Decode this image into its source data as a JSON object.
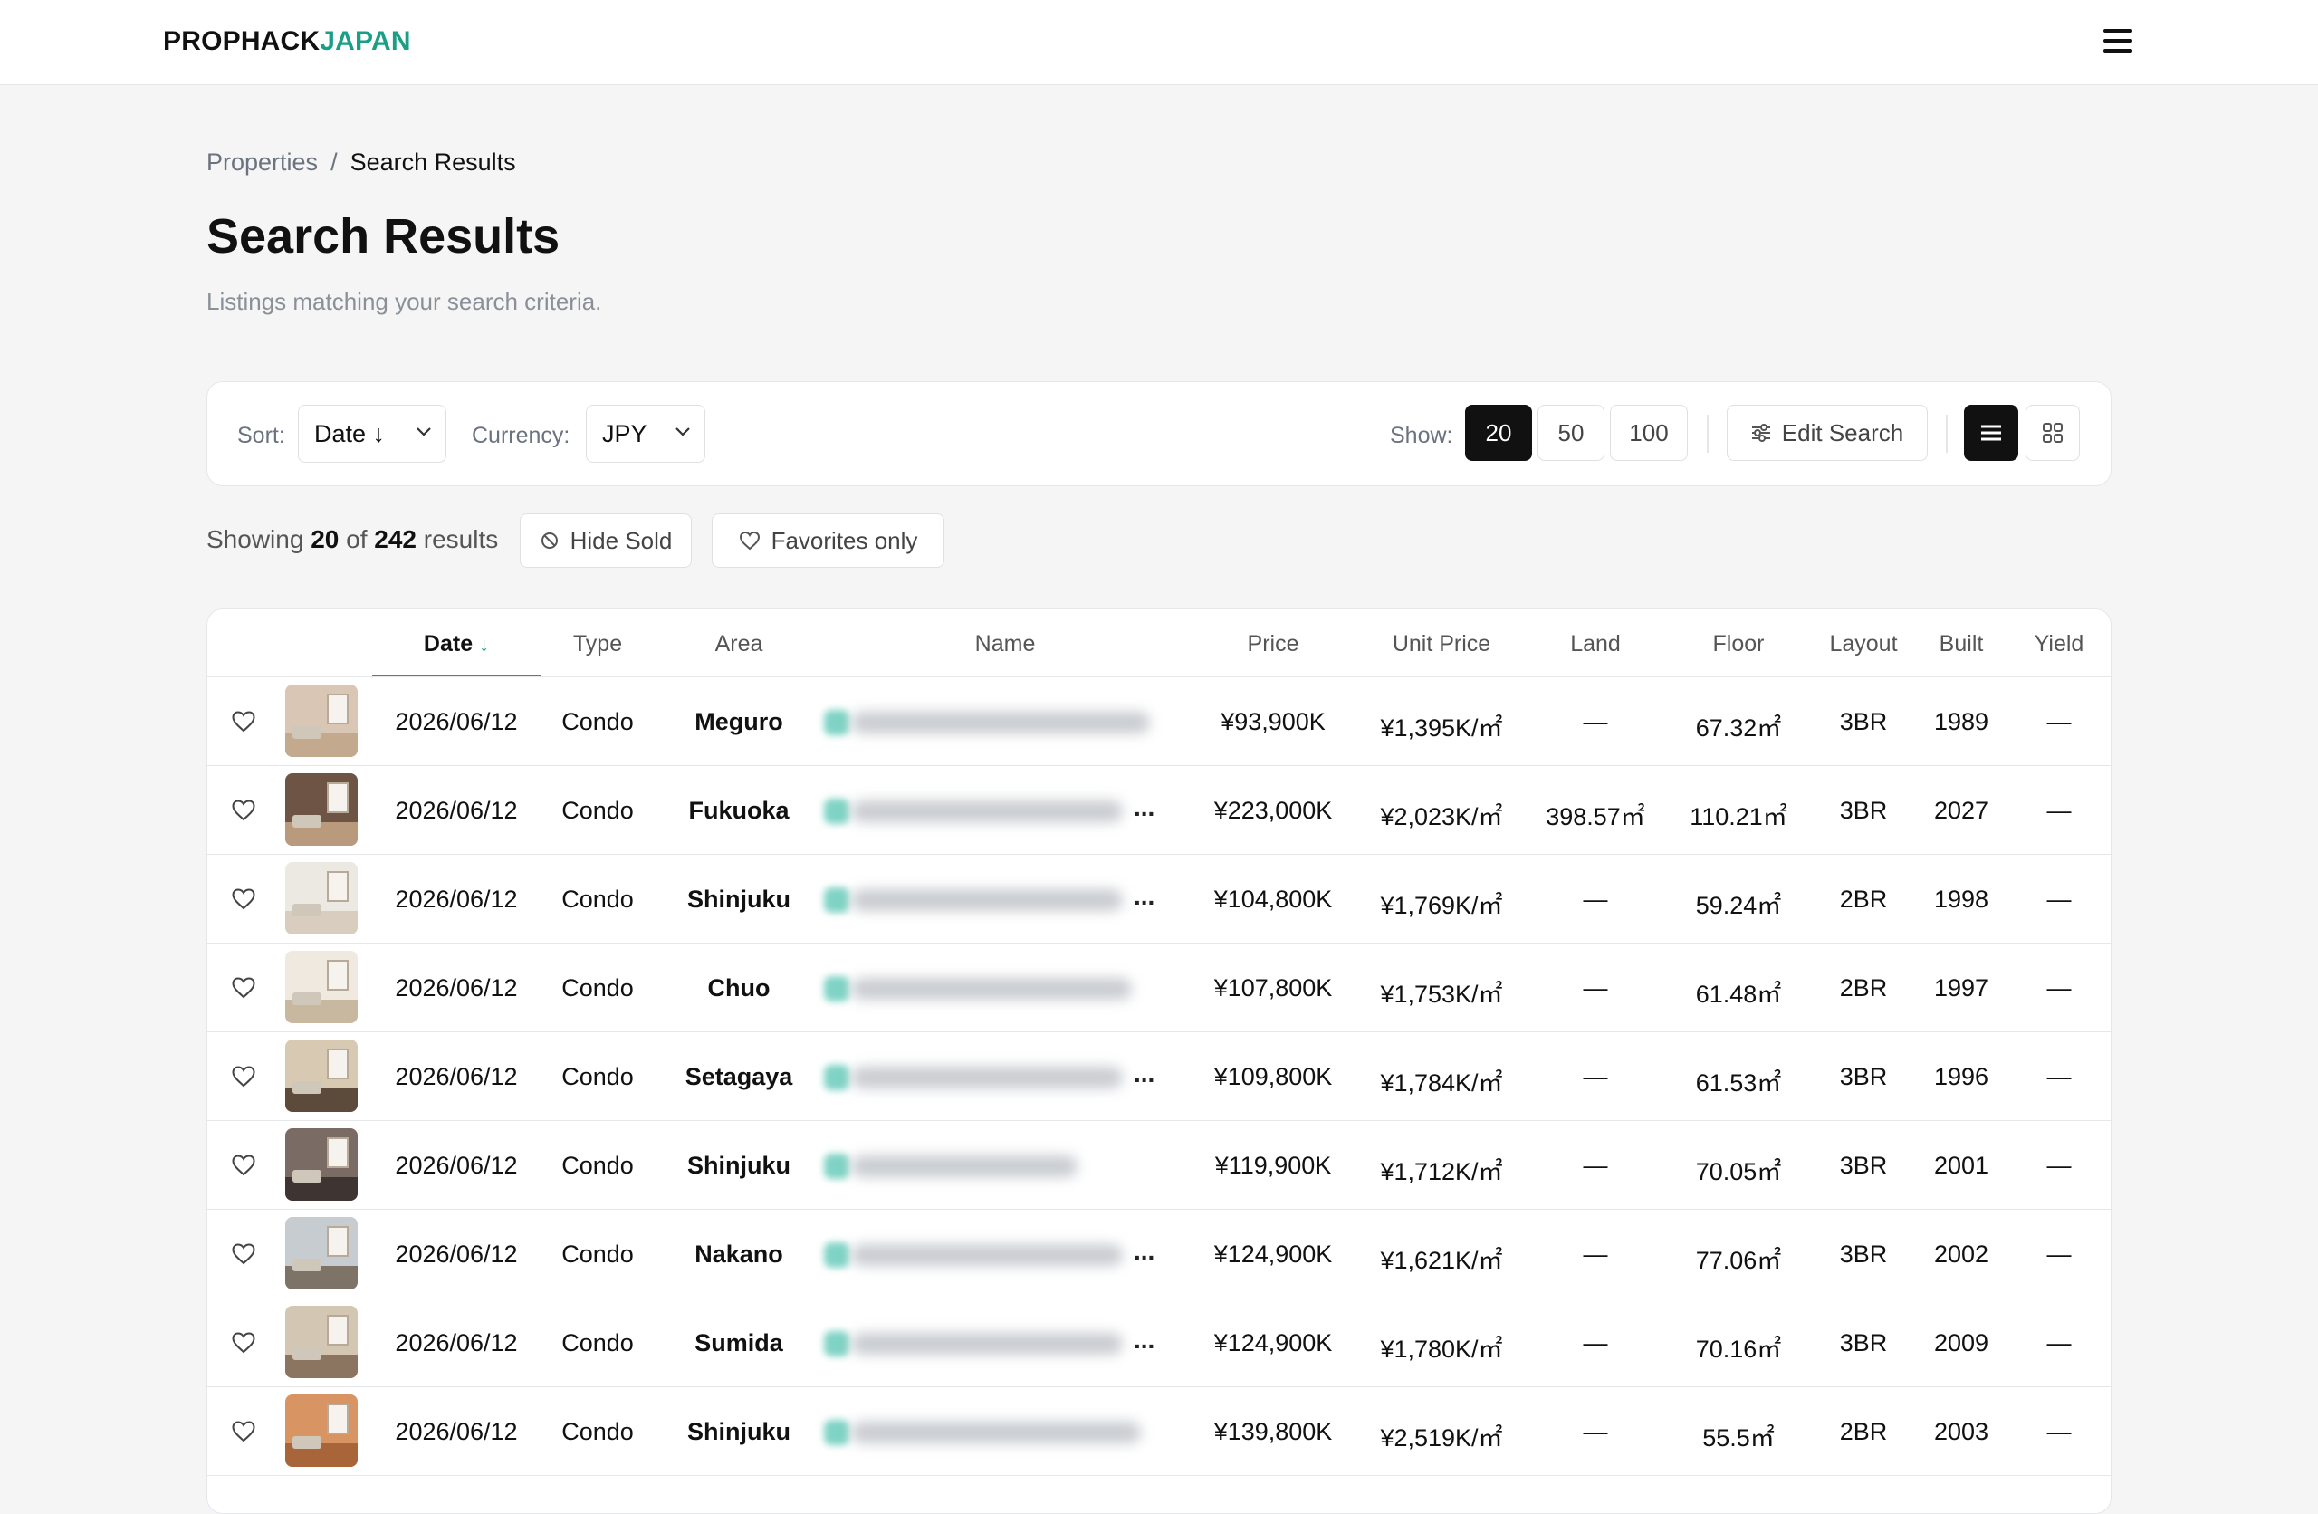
{
  "header": {
    "logo_part1": "PROPHACK",
    "logo_part2": "JAPAN",
    "menu_icon": "hamburger-menu-icon"
  },
  "breadcrumb": {
    "items": [
      "Properties",
      "Search Results"
    ],
    "separator": "/"
  },
  "page": {
    "title": "Search Results",
    "subtitle": "Listings matching your search criteria."
  },
  "toolbar": {
    "sort_label": "Sort:",
    "sort_value": "Date ↓",
    "currency_label": "Currency:",
    "currency_value": "JPY",
    "show_label": "Show:",
    "show_options": [
      "20",
      "50",
      "100"
    ],
    "show_selected": "20",
    "edit_search": "Edit Search",
    "view_modes": [
      "list",
      "grid"
    ],
    "view_selected": "list"
  },
  "summary": {
    "prefix": "Showing",
    "shown": "20",
    "of": "of",
    "total": "242",
    "suffix": "results"
  },
  "filters": {
    "hide_sold": "Hide Sold",
    "favorites_only": "Favorites only"
  },
  "colors": {
    "accent": "#1a9e86",
    "dark": "#111111"
  },
  "table": {
    "columns": [
      "Date",
      "Type",
      "Area",
      "Name",
      "Price",
      "Unit Price",
      "Land",
      "Floor",
      "Layout",
      "Built",
      "Yield"
    ],
    "sort_arrow": "↓",
    "rows": [
      {
        "date": "2026/06/12",
        "type": "Condo",
        "area": "Meguro",
        "price": "¥93,900K",
        "unit_price": "¥1,395K/㎡",
        "land": "—",
        "floor": "67.32㎡",
        "layout": "3BR",
        "built": "1989",
        "yield": "—",
        "name_ellipsis": ""
      },
      {
        "date": "2026/06/12",
        "type": "Condo",
        "area": "Fukuoka",
        "price": "¥223,000K",
        "unit_price": "¥2,023K/㎡",
        "land": "398.57㎡",
        "floor": "110.21㎡",
        "layout": "3BR",
        "built": "2027",
        "yield": "—",
        "name_ellipsis": "..."
      },
      {
        "date": "2026/06/12",
        "type": "Condo",
        "area": "Shinjuku",
        "price": "¥104,800K",
        "unit_price": "¥1,769K/㎡",
        "land": "—",
        "floor": "59.24㎡",
        "layout": "2BR",
        "built": "1998",
        "yield": "—",
        "name_ellipsis": "..."
      },
      {
        "date": "2026/06/12",
        "type": "Condo",
        "area": "Chuo",
        "price": "¥107,800K",
        "unit_price": "¥1,753K/㎡",
        "land": "—",
        "floor": "61.48㎡",
        "layout": "2BR",
        "built": "1997",
        "yield": "—",
        "name_ellipsis": ""
      },
      {
        "date": "2026/06/12",
        "type": "Condo",
        "area": "Setagaya",
        "price": "¥109,800K",
        "unit_price": "¥1,784K/㎡",
        "land": "—",
        "floor": "61.53㎡",
        "layout": "3BR",
        "built": "1996",
        "yield": "—",
        "name_ellipsis": "..."
      },
      {
        "date": "2026/06/12",
        "type": "Condo",
        "area": "Shinjuku",
        "price": "¥119,900K",
        "unit_price": "¥1,712K/㎡",
        "land": "—",
        "floor": "70.05㎡",
        "layout": "3BR",
        "built": "2001",
        "yield": "—",
        "name_ellipsis": ""
      },
      {
        "date": "2026/06/12",
        "type": "Condo",
        "area": "Nakano",
        "price": "¥124,900K",
        "unit_price": "¥1,621K/㎡",
        "land": "—",
        "floor": "77.06㎡",
        "layout": "3BR",
        "built": "2002",
        "yield": "—",
        "name_ellipsis": "..."
      },
      {
        "date": "2026/06/12",
        "type": "Condo",
        "area": "Sumida",
        "price": "¥124,900K",
        "unit_price": "¥1,780K/㎡",
        "land": "—",
        "floor": "70.16㎡",
        "layout": "3BR",
        "built": "2009",
        "yield": "—",
        "name_ellipsis": "..."
      },
      {
        "date": "2026/06/12",
        "type": "Condo",
        "area": "Shinjuku",
        "price": "¥139,800K",
        "unit_price": "¥2,519K/㎡",
        "land": "—",
        "floor": "55.5㎡",
        "layout": "2BR",
        "built": "2003",
        "yield": "—",
        "name_ellipsis": ""
      }
    ]
  }
}
